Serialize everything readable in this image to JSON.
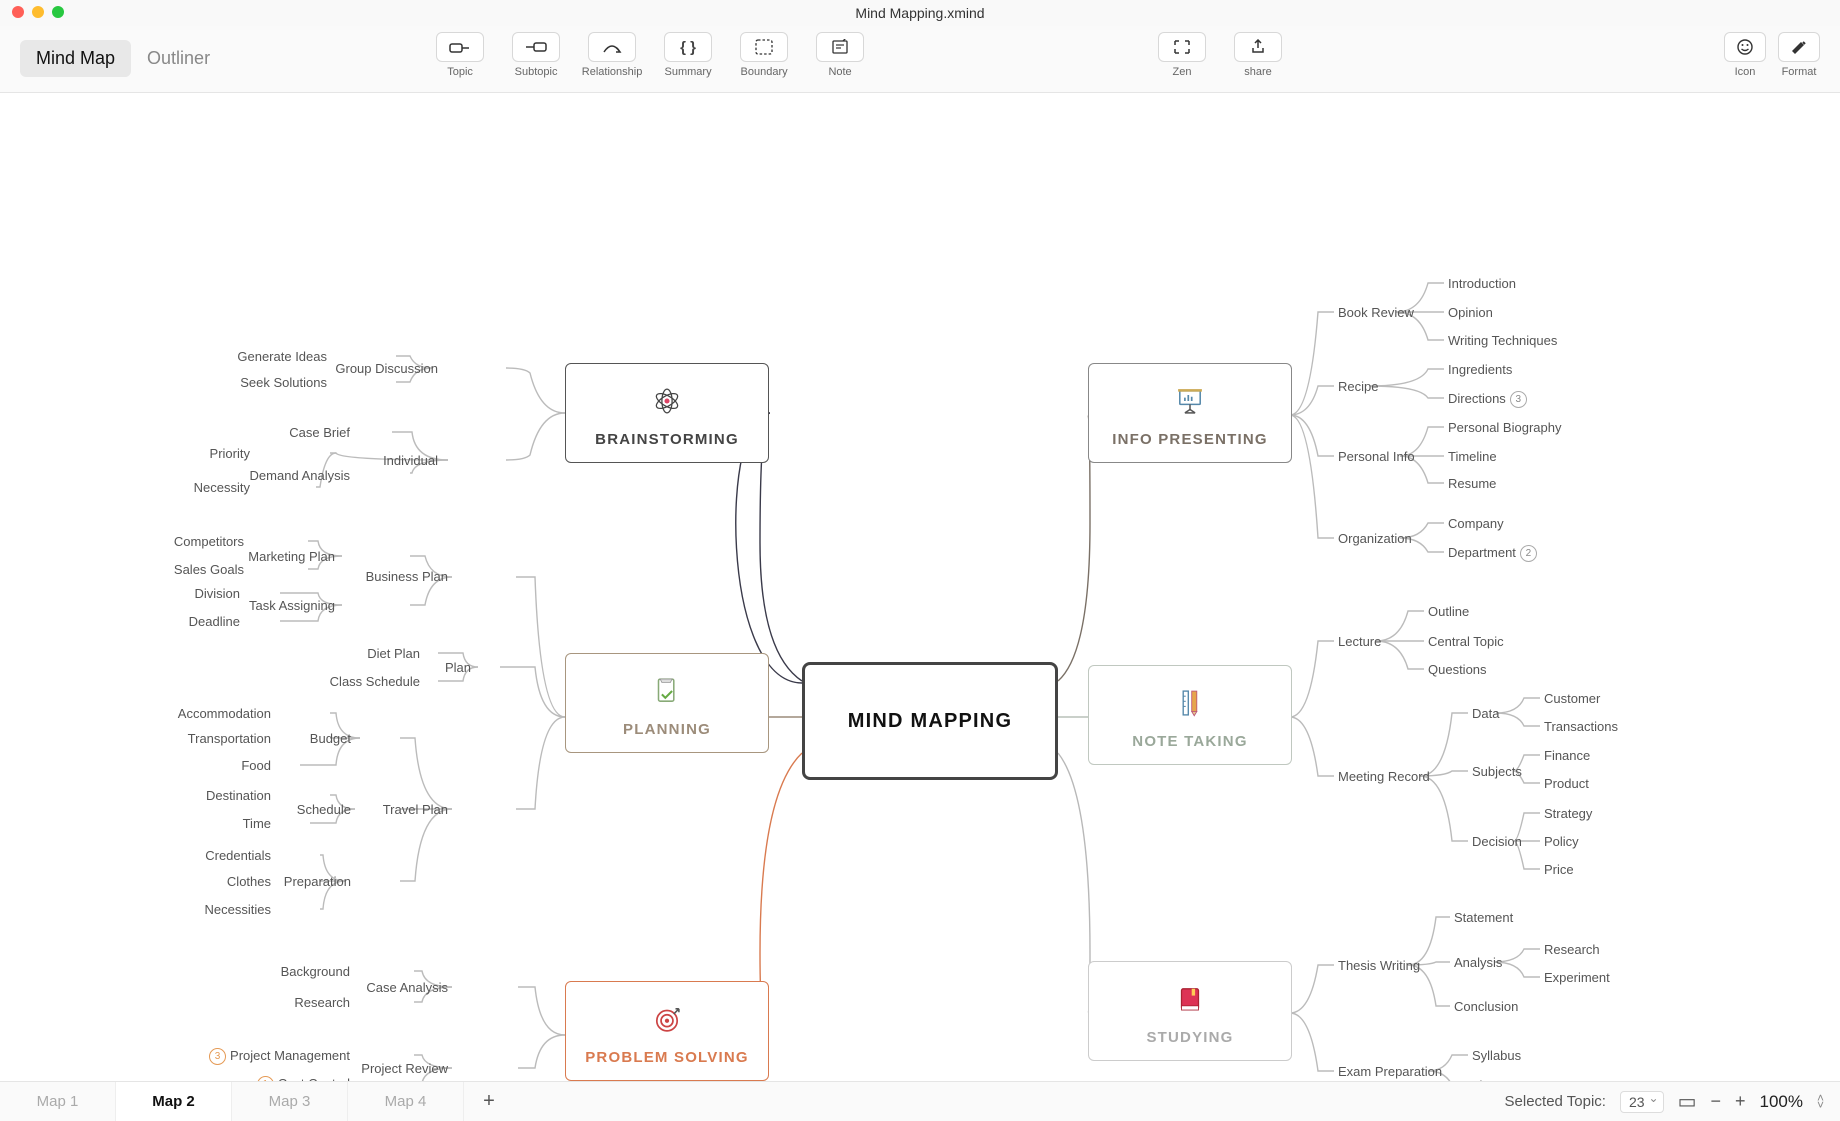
{
  "window": {
    "title": "Mind Mapping.xmind"
  },
  "toolbar": {
    "views": {
      "mind_map": "Mind Map",
      "outliner": "Outliner"
    },
    "tools": {
      "topic": "Topic",
      "subtopic": "Subtopic",
      "relationship": "Relationship",
      "summary": "Summary",
      "boundary": "Boundary",
      "note": "Note",
      "zen": "Zen",
      "share": "share",
      "icon": "Icon",
      "format": "Format"
    }
  },
  "map": {
    "central": "MIND MAPPING",
    "branches": [
      {
        "id": "brainstorming",
        "label": "BRAINSTORMING",
        "side": "left",
        "children": [
          {
            "label": "Group Discussion",
            "children": [
              {
                "label": "Generate Ideas"
              },
              {
                "label": "Seek Solutions"
              }
            ]
          },
          {
            "label": "Individual",
            "children": [
              {
                "label": "Case Brief"
              },
              {
                "label": "Demand Analysis"
              },
              {
                "label": "Priority"
              },
              {
                "label": "Necessity"
              }
            ]
          }
        ]
      },
      {
        "id": "planning",
        "label": "PLANNING",
        "side": "left",
        "children": [
          {
            "label": "Business Plan",
            "children": [
              {
                "label": "Marketing Plan",
                "children": [
                  {
                    "label": "Competitors"
                  },
                  {
                    "label": "Sales Goals"
                  }
                ]
              },
              {
                "label": "Task Assigning",
                "children": [
                  {
                    "label": "Division"
                  },
                  {
                    "label": "Deadline"
                  }
                ]
              }
            ]
          },
          {
            "label": "Plan",
            "children": [
              {
                "label": "Diet Plan"
              },
              {
                "label": "Class Schedule"
              }
            ]
          },
          {
            "label": "Travel Plan",
            "children": [
              {
                "label": "Budget",
                "children": [
                  {
                    "label": "Accommodation"
                  },
                  {
                    "label": "Transportation"
                  },
                  {
                    "label": "Food"
                  }
                ]
              },
              {
                "label": "Schedule",
                "children": [
                  {
                    "label": "Destination"
                  },
                  {
                    "label": "Time"
                  }
                ]
              },
              {
                "label": "Preparation",
                "children": [
                  {
                    "label": "Credentials"
                  },
                  {
                    "label": "Clothes"
                  },
                  {
                    "label": "Necessities"
                  }
                ]
              }
            ]
          }
        ]
      },
      {
        "id": "problem_solving",
        "label": "PROBLEM SOLVING",
        "side": "left",
        "children": [
          {
            "label": "Case Analysis",
            "children": [
              {
                "label": "Background"
              },
              {
                "label": "Research"
              }
            ]
          },
          {
            "label": "Project Review",
            "children": [
              {
                "label": "Project Management",
                "badge": "3"
              },
              {
                "label": "Cost Control",
                "badge": "1"
              }
            ]
          }
        ]
      },
      {
        "id": "info_presenting",
        "label": "INFO PRESENTING",
        "side": "right",
        "children": [
          {
            "label": "Book Review",
            "children": [
              {
                "label": "Introduction"
              },
              {
                "label": "Opinion"
              },
              {
                "label": "Writing Techniques"
              }
            ]
          },
          {
            "label": "Recipe",
            "children": [
              {
                "label": "Ingredients"
              },
              {
                "label": "Directions",
                "badge": "3"
              }
            ]
          },
          {
            "label": "Personal Info",
            "children": [
              {
                "label": "Personal Biography"
              },
              {
                "label": "Timeline"
              },
              {
                "label": "Resume"
              }
            ]
          },
          {
            "label": "Organization",
            "children": [
              {
                "label": "Company"
              },
              {
                "label": "Department",
                "badge": "2"
              }
            ]
          }
        ]
      },
      {
        "id": "note_taking",
        "label": "NOTE TAKING",
        "side": "right",
        "children": [
          {
            "label": "Lecture",
            "children": [
              {
                "label": "Outline"
              },
              {
                "label": "Central Topic"
              },
              {
                "label": "Questions"
              }
            ]
          },
          {
            "label": "Meeting Record",
            "children": [
              {
                "label": "Data",
                "children": [
                  {
                    "label": "Customer"
                  },
                  {
                    "label": "Transactions"
                  }
                ]
              },
              {
                "label": "Subjects",
                "children": [
                  {
                    "label": "Finance"
                  },
                  {
                    "label": "Product"
                  }
                ]
              },
              {
                "label": "Decision",
                "children": [
                  {
                    "label": "Strategy"
                  },
                  {
                    "label": "Policy"
                  },
                  {
                    "label": "Price"
                  }
                ]
              }
            ]
          }
        ]
      },
      {
        "id": "studying",
        "label": "STUDYING",
        "side": "right",
        "children": [
          {
            "label": "Thesis Writing",
            "children": [
              {
                "label": "Statement"
              },
              {
                "label": "Analysis",
                "children": [
                  {
                    "label": "Research"
                  },
                  {
                    "label": "Experiment"
                  }
                ]
              },
              {
                "label": "Conclusion"
              }
            ]
          },
          {
            "label": "Exam Preparation",
            "children": [
              {
                "label": "Syllabus"
              },
              {
                "label": "Time Arrangement"
              }
            ]
          }
        ]
      }
    ]
  },
  "bottombar": {
    "sheets": [
      "Map 1",
      "Map 2",
      "Map 3",
      "Map 4"
    ],
    "active_sheet_index": 1,
    "selected_label": "Selected Topic:",
    "selected_count": "23",
    "zoom": "100%"
  }
}
